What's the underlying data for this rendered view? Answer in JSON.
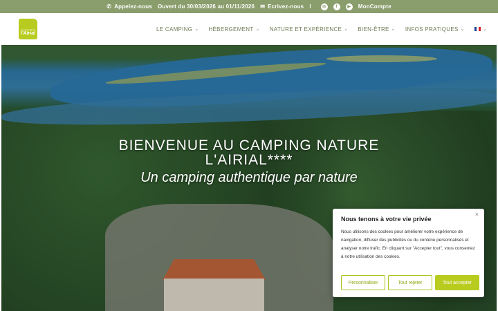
{
  "topbar": {
    "call": "Appelez-nous",
    "open": "Ouvert du 30/03/2026 au 01/11/2026",
    "write": "Ecrivez-nous",
    "separator": "I",
    "account": "MonCompte"
  },
  "logo": {
    "small": "camping nature",
    "big": "l'Airial"
  },
  "nav": {
    "items": [
      {
        "label": "LE CAMPING"
      },
      {
        "label": "HÉBERGEMENT"
      },
      {
        "label": "NATURE ET EXPÉRIENCE"
      },
      {
        "label": "BIEN-ÊTRE"
      },
      {
        "label": "INFOS PRATIQUES"
      }
    ]
  },
  "hero": {
    "title_line1": "BIENVENUE AU CAMPING NATURE",
    "title_line2": "L'AIRIAL****",
    "subtitle": "Un camping authentique par nature"
  },
  "cookie": {
    "title": "Nous tenons à votre vie privée",
    "body": "Nous utilisons des cookies pour améliorer votre expérience de navigation, diffuser des publicités ou du contenu personnalisés et analyser notre trafic. En cliquant sur \"Accepter tout\", vous consentez à notre utilisation des cookies.",
    "btn_customize": "Personnaliser",
    "btn_reject": "Tout rejeter",
    "btn_accept": "Tout accepter"
  },
  "colors": {
    "topbar": "#8a9d6c",
    "accent": "#b8cc1f",
    "nav_text": "#6f7d58"
  }
}
